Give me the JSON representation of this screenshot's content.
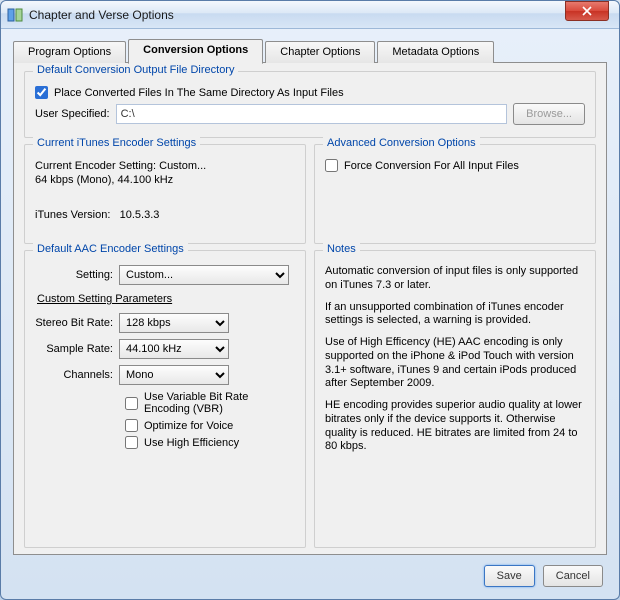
{
  "window": {
    "title": "Chapter and Verse Options"
  },
  "tabs": {
    "program": "Program Options",
    "conversion": "Conversion Options",
    "chapter": "Chapter Options",
    "metadata": "Metadata Options"
  },
  "output_dir": {
    "legend": "Default Conversion Output File Directory",
    "place_same_label": "Place Converted Files In The Same Directory As Input Files",
    "place_same_checked": true,
    "user_specified_label": "User Specified:",
    "user_specified_value": "C:\\",
    "browse_label": "Browse..."
  },
  "current_encoder": {
    "legend": "Current iTunes Encoder Settings",
    "line1": "Current Encoder Setting:  Custom...",
    "line2": "64 kbps (Mono), 44.100 kHz",
    "itunes_version_label": "iTunes Version:",
    "itunes_version_value": "10.5.3.3"
  },
  "advanced": {
    "legend": "Advanced Conversion Options",
    "force_label": "Force Conversion For All Input Files",
    "force_checked": false
  },
  "aac": {
    "legend": "Default AAC Encoder Settings",
    "setting_label": "Setting:",
    "setting_value": "Custom...",
    "custom_params_label": "Custom Setting Parameters",
    "stereo_bitrate_label": "Stereo Bit Rate:",
    "stereo_bitrate_value": "128 kbps",
    "sample_rate_label": "Sample Rate:",
    "sample_rate_value": "44.100 kHz",
    "channels_label": "Channels:",
    "channels_value": "Mono",
    "vbr_label": "Use Variable Bit Rate Encoding (VBR)",
    "vbr_checked": false,
    "voice_label": "Optimize for Voice",
    "voice_checked": false,
    "he_label": "Use High Efficiency",
    "he_checked": false
  },
  "notes": {
    "legend": "Notes",
    "p1": "Automatic conversion of input files is only supported on iTunes 7.3 or later.",
    "p2": "If an unsupported combination of iTunes encoder settings is selected, a warning is provided.",
    "p3": "Use of High Efficency (HE) AAC encoding is only supported on the iPhone & iPod Touch with version 3.1+ software, iTunes 9 and certain iPods produced after September 2009.",
    "p4": "HE encoding provides superior audio quality at lower bitrates only if the device supports it.  Otherwise quality is reduced.  HE bitrates are limited from 24 to 80 kbps."
  },
  "footer": {
    "save": "Save",
    "cancel": "Cancel"
  }
}
